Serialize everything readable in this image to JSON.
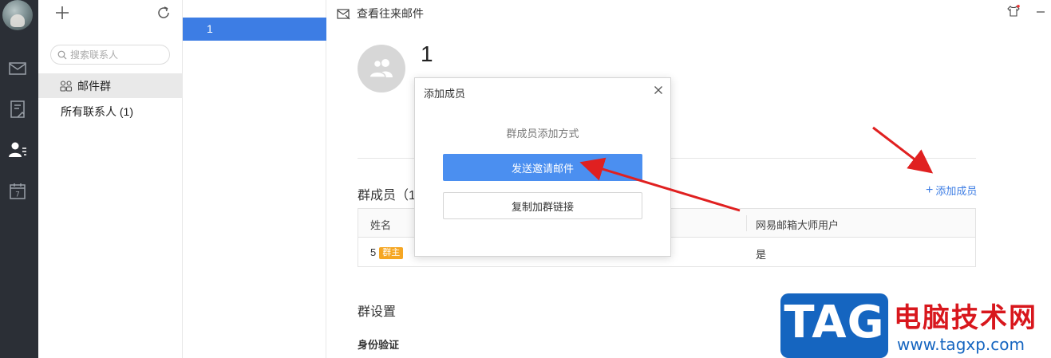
{
  "sidebar": {
    "icons": [
      "avatar",
      "mail-icon",
      "notes-icon",
      "contacts-icon",
      "calendar-icon"
    ],
    "calendar_day": "7"
  },
  "contacts": {
    "search_placeholder": "搜索联系人",
    "group_label": "邮件群",
    "all_contacts_label": "所有联系人 (1)"
  },
  "list": {
    "items": [
      "1"
    ]
  },
  "main": {
    "topbar_link": "查看往来邮件",
    "group_name": "1",
    "members_title": "群成员（1",
    "add_member": "添加成员",
    "add_member_plus": "+",
    "table": {
      "headers": [
        "姓名",
        "网易邮箱大师用户"
      ],
      "rows": [
        {
          "name": "5",
          "badge": "群主",
          "is_master_user": "是"
        }
      ]
    },
    "settings_title": "群设置",
    "identity_title": "身份验证"
  },
  "dialog": {
    "title": "添加成员",
    "subtitle": "群成员添加方式",
    "primary_button": "发送邀请邮件",
    "secondary_button": "复制加群链接"
  },
  "watermark": {
    "logo": "TAG",
    "site_name": "电脑技术网",
    "url": "www.tagxp.com"
  },
  "colors": {
    "accent": "#3d7de4",
    "primary_button": "#4b8ff0",
    "rail": "#2b2f36",
    "badge": "#f5a623",
    "annotation_arrow": "#e02020"
  }
}
